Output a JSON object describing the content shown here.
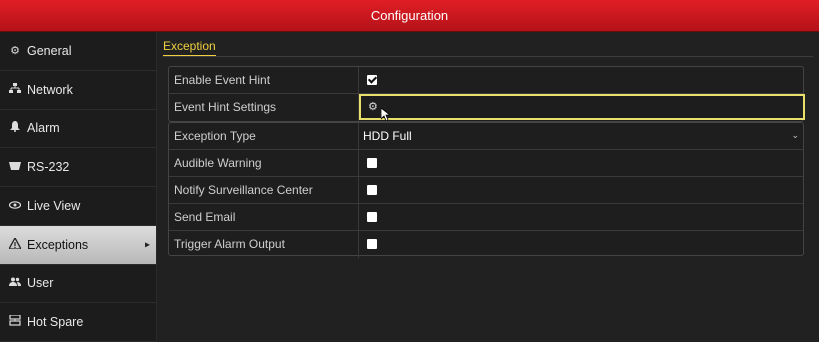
{
  "window": {
    "title": "Configuration"
  },
  "sidebar": {
    "items": [
      {
        "label": "General",
        "icon": "gear-icon",
        "glyph": "⚙"
      },
      {
        "label": "Network",
        "icon": "network-icon",
        "glyph": "⊞"
      },
      {
        "label": "Alarm",
        "icon": "alarm-bell-icon",
        "glyph": "♣"
      },
      {
        "label": "RS-232",
        "icon": "serial-port-icon",
        "glyph": "▬"
      },
      {
        "label": "Live View",
        "icon": "eye-icon",
        "glyph": "◉"
      },
      {
        "label": "Exceptions",
        "icon": "warning-icon",
        "glyph": "⚠",
        "active": true
      },
      {
        "label": "User",
        "icon": "users-icon",
        "glyph": "👥"
      },
      {
        "label": "Hot Spare",
        "icon": "hot-spare-icon",
        "glyph": "⊟"
      }
    ]
  },
  "main": {
    "tab_label": "Exception",
    "panel1": {
      "enable_event_hint": {
        "label": "Enable Event Hint",
        "checked": true
      },
      "event_hint_settings": {
        "label": "Event Hint Settings",
        "icon": "gear-icon"
      }
    },
    "panel2": {
      "exception_type": {
        "label": "Exception Type",
        "value": "HDD Full"
      },
      "audible_warning": {
        "label": "Audible Warning",
        "checked": false
      },
      "notify_surveillance_center": {
        "label": "Notify Surveillance Center",
        "checked": false
      },
      "send_email": {
        "label": "Send Email",
        "checked": false
      },
      "trigger_alarm_output": {
        "label": "Trigger Alarm Output",
        "checked": false
      }
    }
  },
  "colors": {
    "title_bar": "#d41a21",
    "tab_accent": "#f0d040",
    "focus_border": "#e8e06a"
  }
}
